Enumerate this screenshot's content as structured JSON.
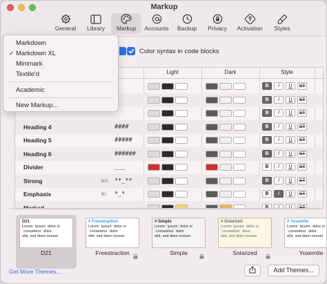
{
  "window": {
    "title": "Markup"
  },
  "toolbar": {
    "tabs": [
      {
        "label": "General",
        "icon": "gear-icon"
      },
      {
        "label": "Library",
        "icon": "library-icon"
      },
      {
        "label": "Markup",
        "icon": "palette-icon"
      },
      {
        "label": "Accounts",
        "icon": "at-icon"
      },
      {
        "label": "Backup",
        "icon": "clock-icon"
      },
      {
        "label": "Privacy",
        "icon": "privacy-icon"
      },
      {
        "label": "Activation",
        "icon": "key-icon"
      },
      {
        "label": "Styles",
        "icon": "brush-icon"
      }
    ],
    "selected": "Markup"
  },
  "markup_menu": {
    "items": [
      "Markdown",
      "Markdown XL",
      "Minimark",
      "Textile'd",
      "Academic",
      "New Markup..."
    ],
    "checked": "Markdown XL"
  },
  "color_syntax": {
    "label": "Color syntax in code blocks",
    "checked": true
  },
  "table": {
    "headers": {
      "light": "Light",
      "dark": "Dark",
      "style": "Style"
    },
    "style_buttons": [
      "B",
      "I",
      "U",
      "ST"
    ],
    "rows": [
      {
        "name": "",
        "shortcut": "",
        "markup": "",
        "light": [
          "#dcdcdc",
          "#2b2b2b",
          "#ffffff"
        ],
        "dark": [
          "#5a5a5a",
          "#f0f0f0",
          "#ffffff"
        ],
        "style_on": [
          true,
          false,
          false,
          false
        ]
      },
      {
        "name": "",
        "shortcut": "",
        "markup": "",
        "light": [
          "#dcdcdc",
          "#2b2b2b",
          "#ffffff"
        ],
        "dark": [
          "#5a5a5a",
          "#f0f0f0",
          "#ffffff"
        ],
        "style_on": [
          true,
          false,
          false,
          false
        ]
      },
      {
        "name": "",
        "shortcut": "",
        "markup": "",
        "light": [
          "#dcdcdc",
          "#2b2b2b",
          "#ffffff"
        ],
        "dark": [
          "#5a5a5a",
          "#f0f0f0",
          "#ffffff"
        ],
        "style_on": [
          true,
          false,
          false,
          false
        ]
      },
      {
        "name": "Heading 4",
        "shortcut": "",
        "markup": "####",
        "light": [
          "#dcdcdc",
          "#2b2b2b",
          "#ffffff"
        ],
        "dark": [
          "#5a5a5a",
          "#f0f0f0",
          "#ffffff"
        ],
        "style_on": [
          true,
          false,
          false,
          false
        ]
      },
      {
        "name": "Heading 5",
        "shortcut": "",
        "markup": "#####",
        "light": [
          "#dcdcdc",
          "#2b2b2b",
          "#ffffff"
        ],
        "dark": [
          "#5a5a5a",
          "#f0f0f0",
          "#ffffff"
        ],
        "style_on": [
          true,
          false,
          false,
          false
        ]
      },
      {
        "name": "Heading 6",
        "shortcut": "",
        "markup": "######",
        "light": [
          "#dcdcdc",
          "#2b2b2b",
          "#ffffff"
        ],
        "dark": [
          "#5a5a5a",
          "#f0f0f0",
          "#ffffff"
        ],
        "style_on": [
          true,
          false,
          false,
          false
        ]
      },
      {
        "name": "Divider",
        "shortcut": "",
        "markup": "___",
        "light": [
          "#d0312d",
          "#2b2b2b",
          "#ffffff"
        ],
        "dark": [
          "#d0312d",
          "#f0f0f0",
          "#ffffff"
        ],
        "style_on": [
          false,
          false,
          false,
          false
        ]
      },
      {
        "name": "Strong",
        "shortcut": "⌘B",
        "markup": "**_**",
        "light": [
          "#dcdcdc",
          "#2b2b2b",
          "#ffffff"
        ],
        "dark": [
          "#5a5a5a",
          "#f0f0f0",
          "#ffffff"
        ],
        "style_on": [
          true,
          false,
          false,
          false
        ]
      },
      {
        "name": "Emphasis",
        "shortcut": "⌘I",
        "markup": "*_*",
        "light": [
          "#dcdcdc",
          "#2b2b2b",
          "#ffffff"
        ],
        "dark": [
          "#5a5a5a",
          "#f0f0f0",
          "#ffffff"
        ],
        "style_on": [
          false,
          true,
          false,
          false
        ]
      },
      {
        "name": "Marked",
        "shortcut": "",
        "markup": "",
        "light": [
          "#dcdcdc",
          "#2b2b2b",
          "#f5d36a"
        ],
        "dark": [
          "#5a5a5a",
          "#e5b94a",
          "#ffffff"
        ],
        "style_on": [
          false,
          false,
          false,
          false
        ]
      }
    ]
  },
  "themes": [
    {
      "name": "D21",
      "header": "D21",
      "line1": "Lorem `ipsum` dolor si",
      "line2": "`consetetur` dolor",
      "line3": "elitr, sed diam nonum",
      "bg": "#ffffff",
      "fg": "#2a2627",
      "accent": "#2a2627",
      "selected": true,
      "locked": false
    },
    {
      "name": "Freestraction",
      "header": "# Freestraction",
      "line1": "Lorem `ipsum` dolor si",
      "line2": "`consetetur` dolor",
      "line3": "elitr, sed diam nonum",
      "bg": "#ffffff",
      "fg": "#2a2627",
      "accent": "#2f9fd8",
      "selected": false,
      "locked": true
    },
    {
      "name": "Simple",
      "header": "# Simple",
      "line1": "Lorem `ipsum` dolor si",
      "line2": "`consetetur` dolor",
      "line3": "elitr, sed diam nonum",
      "bg": "#f4f3f2",
      "fg": "#2a2627",
      "accent": "#2a2627",
      "selected": false,
      "locked": true
    },
    {
      "name": "Solarized",
      "header": "# Solarized",
      "line1": "Lorem `ipsum` dolor si",
      "line2": "`consetetur` dolor",
      "line3": "elitr, sed diam nonum",
      "bg": "#fdf6e3",
      "fg": "#586e75",
      "accent": "#586e75",
      "selected": false,
      "locked": true
    },
    {
      "name": "Yosemite",
      "header": "# Yosemite",
      "line1": "Lorem `ipsum` dolor si",
      "line2": "`consetetur` dolor",
      "line3": "elitr, sed diam nonum",
      "bg": "#ffffff",
      "fg": "#2a2627",
      "accent": "#2f9fd8",
      "selected": false,
      "locked": true
    }
  ],
  "footer": {
    "get_more": "Get More Themes...",
    "add_themes": "Add Themes..."
  }
}
